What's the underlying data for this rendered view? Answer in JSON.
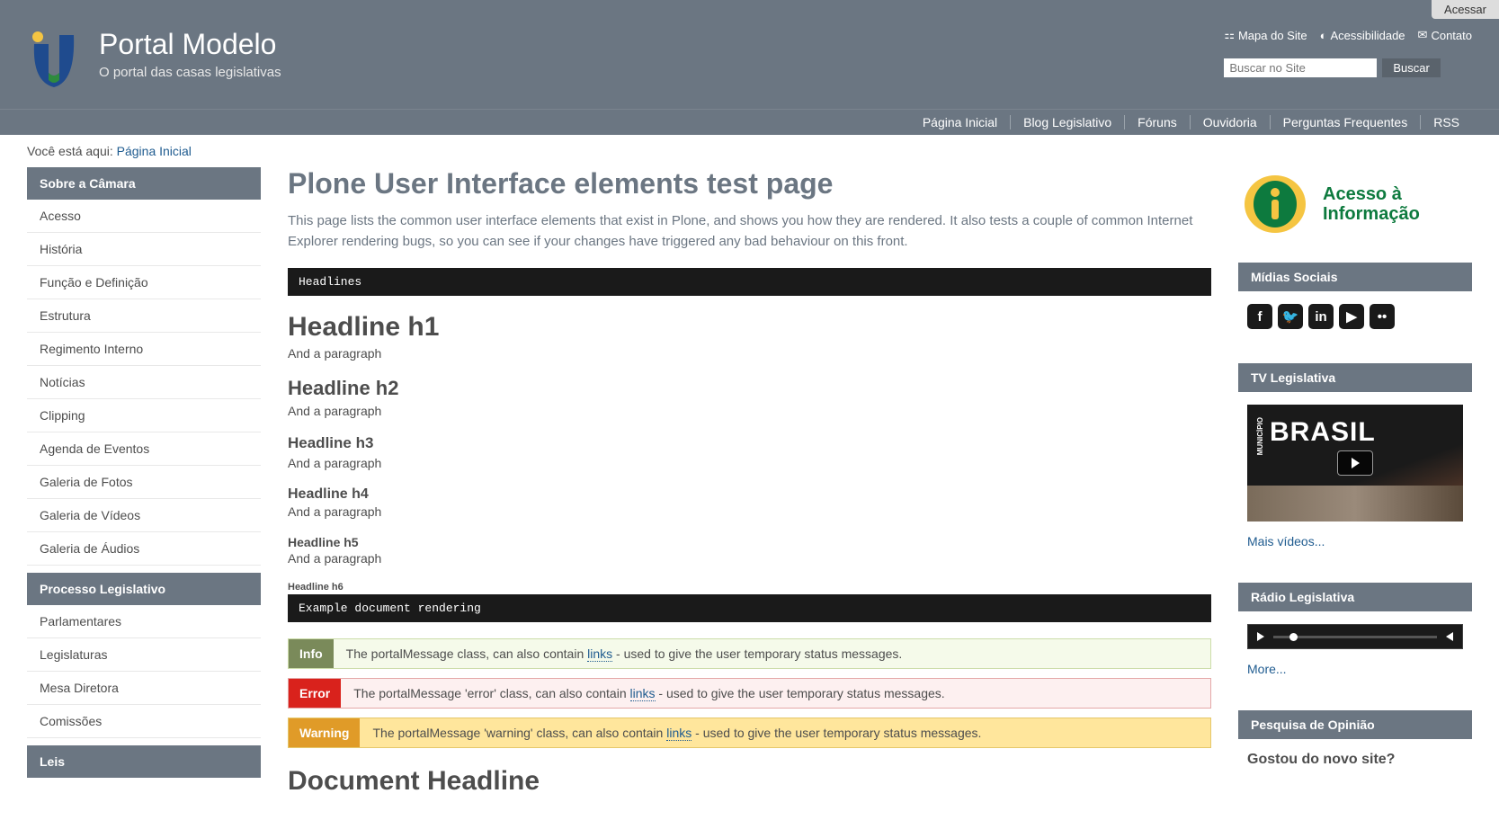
{
  "top": {
    "acessar": "Acessar"
  },
  "header": {
    "title": "Portal Modelo",
    "subtitle": "O portal das casas legislativas"
  },
  "siteactions": [
    {
      "label": "Mapa do Site",
      "icon": "sitemap"
    },
    {
      "label": "Acessibilidade",
      "icon": "accessibility"
    },
    {
      "label": "Contato",
      "icon": "envelope"
    }
  ],
  "search": {
    "placeholder": "Buscar no Site",
    "button": "Buscar"
  },
  "navbar": [
    "Página Inicial",
    "Blog Legislativo",
    "Fóruns",
    "Ouvidoria",
    "Perguntas Frequentes",
    "RSS"
  ],
  "breadcrumb": {
    "prefix": "Você está aqui:",
    "current": "Página Inicial"
  },
  "left_nav": [
    {
      "header": "Sobre a Câmara",
      "items": [
        "Acesso",
        "História",
        "Função e Definição",
        "Estrutura",
        "Regimento Interno",
        "Notícias",
        "Clipping",
        "Agenda de Eventos",
        "Galeria de Fotos",
        "Galeria de Vídeos",
        "Galeria de Áudios"
      ]
    },
    {
      "header": "Processo Legislativo",
      "items": [
        "Parlamentares",
        "Legislaturas",
        "Mesa Diretora",
        "Comissões"
      ]
    },
    {
      "header": "Leis",
      "items": []
    }
  ],
  "content": {
    "page_title": "Plone User Interface elements test page",
    "page_desc": "This page lists the common user interface elements that exist in Plone, and shows you how they are rendered. It also tests a couple of common Internet Explorer rendering bugs, so you can see if your changes have triggered any bad behaviour on this front.",
    "code_headlines": "Headlines",
    "headlines": [
      {
        "tag": "h1",
        "title": "Headline h1",
        "para": "And a paragraph"
      },
      {
        "tag": "h2",
        "title": "Headline h2",
        "para": "And a paragraph"
      },
      {
        "tag": "h3",
        "title": "Headline h3",
        "para": "And a paragraph"
      },
      {
        "tag": "h4",
        "title": "Headline h4",
        "para": "And a paragraph"
      },
      {
        "tag": "h5",
        "title": "Headline h5",
        "para": "And a paragraph"
      },
      {
        "tag": "h6",
        "title": "Headline h6",
        "para": ""
      }
    ],
    "code_example": "Example document rendering",
    "messages": {
      "info": {
        "tag": "Info",
        "pre": "The portalMessage class, can also contain ",
        "link": "links",
        "post": " - used to give the user temporary status messages."
      },
      "error": {
        "tag": "Error",
        "pre": "The portalMessage 'error' class, can also contain ",
        "link": "links",
        "post": " - used to give the user temporary status messages."
      },
      "warning": {
        "tag": "Warning",
        "pre": "The portalMessage 'warning' class, can also contain ",
        "link": "links",
        "post": " - used to give the user temporary status messages."
      }
    },
    "doc_headline": "Document Headline"
  },
  "right": {
    "acesso": {
      "line1": "Acesso à",
      "line2": "Informação"
    },
    "midias": {
      "title": "Mídias Sociais",
      "icons": [
        "f",
        "🐦",
        "in",
        "▶",
        "••"
      ]
    },
    "tv": {
      "title": "TV Legislativa",
      "big": "BRASIL",
      "small": "MUNICÍPIO",
      "more": "Mais vídeos..."
    },
    "radio": {
      "title": "Rádio Legislativa",
      "more": "More..."
    },
    "poll": {
      "title": "Pesquisa de Opinião",
      "question": "Gostou do novo site?"
    }
  }
}
